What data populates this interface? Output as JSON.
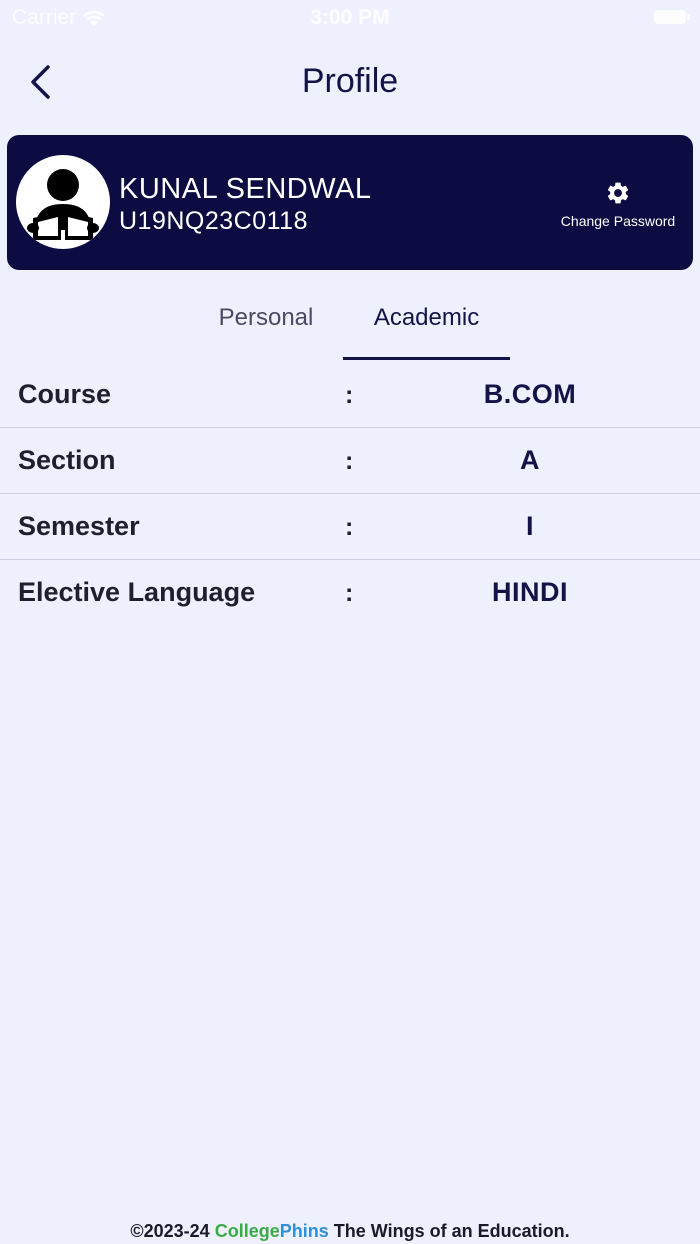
{
  "status_bar": {
    "carrier": "Carrier",
    "time": "3:00 PM"
  },
  "nav": {
    "title": "Profile"
  },
  "profile": {
    "name": "KUNAL SENDWAL",
    "id": "U19NQ23C0118",
    "change_password_label": "Change Password"
  },
  "tabs": [
    {
      "label": "Personal",
      "active": false
    },
    {
      "label": "Academic",
      "active": true
    }
  ],
  "academic": {
    "rows": [
      {
        "label": "Course",
        "separator": ":",
        "value": "B.COM"
      },
      {
        "label": "Section",
        "separator": ":",
        "value": "A"
      },
      {
        "label": "Semester",
        "separator": ":",
        "value": "I"
      },
      {
        "label": "Elective Language",
        "separator": ":",
        "value": "HINDI"
      }
    ]
  },
  "footer": {
    "prefix": "©2023-24",
    "brand_part1": "College",
    "brand_part2": "Phins",
    "suffix": "The Wings of an Education."
  },
  "colors": {
    "background": "#eef0fd",
    "card": "#0c0c43",
    "accent": "#131347",
    "brand_green": "#3aaa46",
    "brand_blue": "#2f8fd8"
  }
}
